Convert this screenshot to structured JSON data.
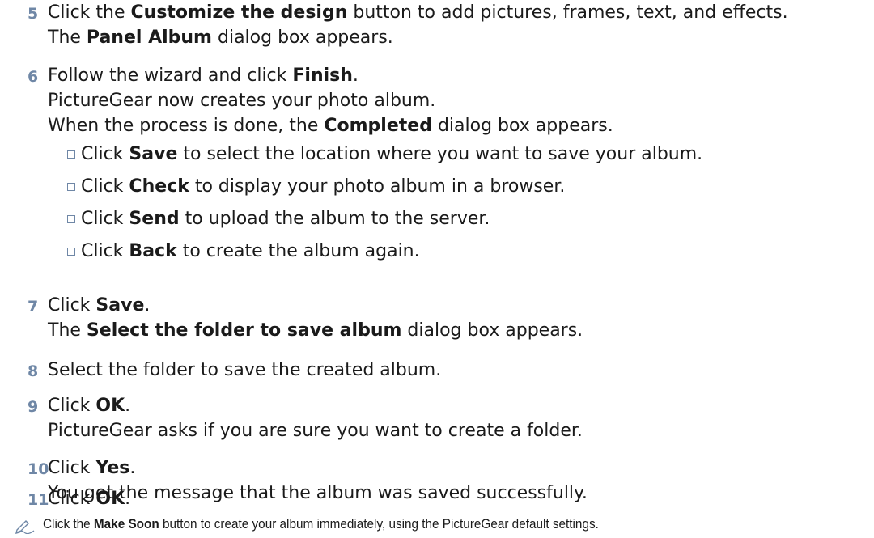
{
  "steps": [
    {
      "number": "5",
      "lines": [
        [
          {
            "t": "Click the "
          },
          {
            "t": "Customize the design",
            "b": true
          },
          {
            "t": " button to add pictures, frames, text, and effects."
          }
        ],
        [
          {
            "t": "The "
          },
          {
            "t": "Panel Album",
            "b": true
          },
          {
            "t": " dialog box appears."
          }
        ]
      ]
    },
    {
      "number": "6",
      "lines": [
        [
          {
            "t": "Follow the wizard and click "
          },
          {
            "t": "Finish",
            "b": true
          },
          {
            "t": "."
          }
        ],
        [
          {
            "t": "PictureGear now creates your photo album."
          }
        ],
        [
          {
            "t": "When the process is done, the "
          },
          {
            "t": "Completed",
            "b": true
          },
          {
            "t": " dialog box appears."
          }
        ]
      ],
      "bullets": [
        [
          {
            "t": "Click "
          },
          {
            "t": "Save",
            "b": true
          },
          {
            "t": " to select the location where you want to save your album."
          }
        ],
        [
          {
            "t": "Click "
          },
          {
            "t": "Check",
            "b": true
          },
          {
            "t": " to display your photo album in a browser."
          }
        ],
        [
          {
            "t": "Click "
          },
          {
            "t": "Send",
            "b": true
          },
          {
            "t": " to upload the album to the server."
          }
        ],
        [
          {
            "t": "Click "
          },
          {
            "t": "Back",
            "b": true
          },
          {
            "t": " to create the album again."
          }
        ]
      ]
    },
    {
      "number": "7",
      "lines": [
        [
          {
            "t": "Click "
          },
          {
            "t": "Save",
            "b": true
          },
          {
            "t": "."
          }
        ],
        [
          {
            "t": "The "
          },
          {
            "t": "Select the folder to save album",
            "b": true
          },
          {
            "t": " dialog box appears."
          }
        ]
      ]
    },
    {
      "number": "8",
      "lines": [
        [
          {
            "t": "Select the folder to save the created album."
          }
        ]
      ]
    },
    {
      "number": "9",
      "lines": [
        [
          {
            "t": "Click "
          },
          {
            "t": "OK",
            "b": true
          },
          {
            "t": "."
          }
        ],
        [
          {
            "t": "PictureGear asks if you are sure you want to create a folder."
          }
        ]
      ]
    },
    {
      "number": "10",
      "lines": [
        [
          {
            "t": "Click "
          },
          {
            "t": "Yes",
            "b": true
          },
          {
            "t": "."
          }
        ],
        [
          {
            "t": "You get the message that the album was saved successfully."
          }
        ]
      ]
    },
    {
      "number": "11",
      "lines": [
        [
          {
            "t": "Click "
          },
          {
            "t": "OK",
            "b": true
          },
          {
            "t": "."
          }
        ]
      ]
    }
  ],
  "note": {
    "icon": "pencil-note-icon",
    "parts": [
      {
        "t": "Click the "
      },
      {
        "t": "Make Soon",
        "b": true
      },
      {
        "t": " button to create your album immediately, using the PictureGear default settings."
      }
    ]
  }
}
